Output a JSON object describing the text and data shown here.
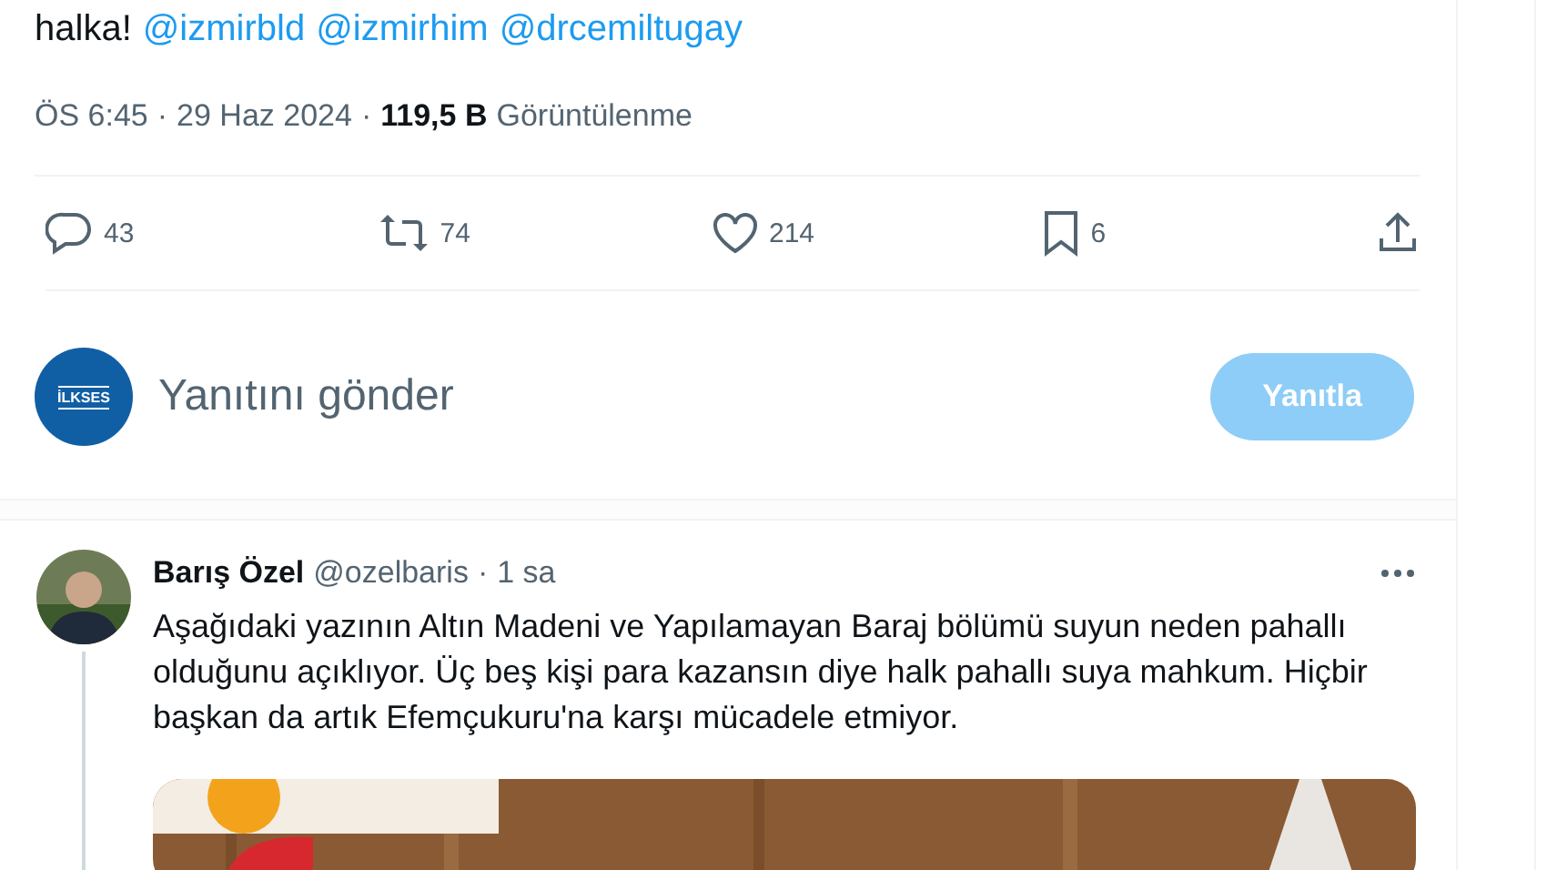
{
  "tweet": {
    "text": "halka!",
    "mentions": [
      "@izmirbld",
      "@izmirhim",
      "@drcemiltugay"
    ],
    "time": "ÖS 6:45",
    "separator": "·",
    "date": "29 Haz 2024",
    "views": "119,5 B",
    "views_label": "Görüntülenme"
  },
  "actions": [
    {
      "kind": "reply",
      "count": "43"
    },
    {
      "kind": "retweet",
      "count": "74"
    },
    {
      "kind": "like",
      "count": "214"
    },
    {
      "kind": "bookmark",
      "count": "6"
    },
    {
      "kind": "share"
    }
  ],
  "composer": {
    "avatar_label": "İLKSES",
    "placeholder": "Yanıtını gönder",
    "button": "Yanıtla",
    "disabled": true
  },
  "reply": {
    "name": "Barış Özel",
    "handle": "@ozelbaris",
    "separator": "·",
    "time": "1 sa",
    "text": "Aşağıdaki yazının Altın Madeni ve Yapılamayan Baraj bölümü suyun neden pahallı olduğunu açıklıyor. Üç beş kişi para kazansın diye halk pahallı suya mahkum. Hiçbir başkan da artık Efemçukuru'na karşı mücadele etmiyor."
  }
}
